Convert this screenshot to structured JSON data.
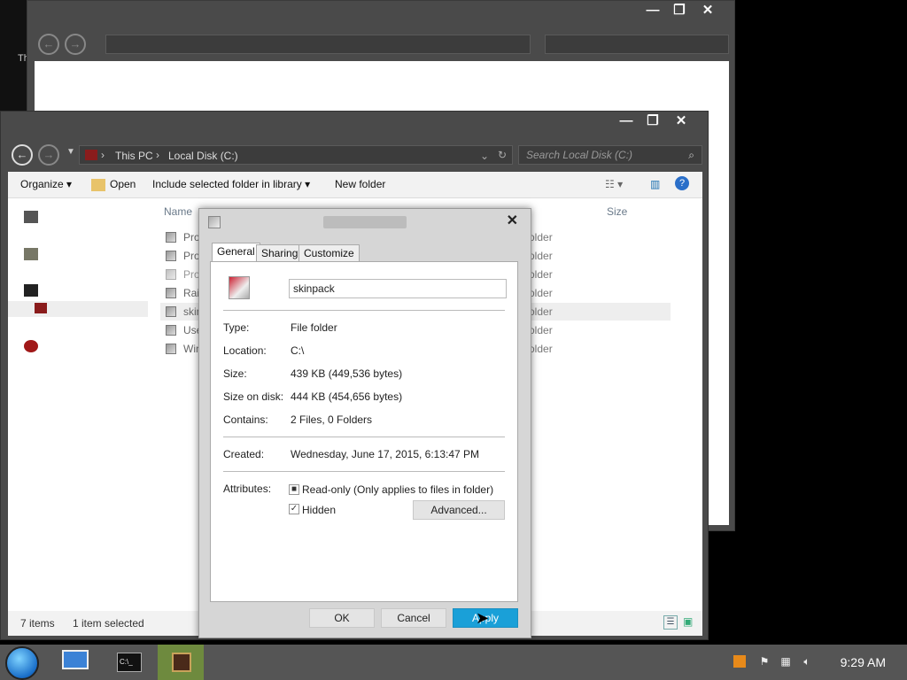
{
  "front_window": {
    "breadcrumb": [
      "This PC",
      "Local Disk (C:)"
    ],
    "search_placeholder": "Search Local Disk (C:)",
    "toolbar": {
      "organize": "Organize",
      "open": "Open",
      "include": "Include selected folder in library",
      "new_folder": "New folder"
    },
    "columns": {
      "name": "Name",
      "size": "Size"
    },
    "files": [
      {
        "name": "Pro",
        "type": "older"
      },
      {
        "name": "Pro",
        "type": "older"
      },
      {
        "name": "Pro",
        "type": "older"
      },
      {
        "name": "Rai",
        "type": "older"
      },
      {
        "name": "skin",
        "type": "older"
      },
      {
        "name": "Use",
        "type": "older"
      },
      {
        "name": "Win",
        "type": "older"
      }
    ],
    "status": {
      "items": "7 items",
      "selected": "1 item selected"
    }
  },
  "dialog": {
    "tabs": [
      "General",
      "Sharing",
      "Customize"
    ],
    "folder_name": "skinpack",
    "type_label": "Type:",
    "type_value": "File folder",
    "location_label": "Location:",
    "location_value": "C:\\",
    "size_label": "Size:",
    "size_value": "439 KB (449,536 bytes)",
    "size_on_disk_label": "Size on disk:",
    "size_on_disk_value": "444 KB (454,656 bytes)",
    "contains_label": "Contains:",
    "contains_value": "2 Files, 0 Folders",
    "created_label": "Created:",
    "created_value": "Wednesday, June 17, 2015, 6:13:47 PM",
    "attributes_label": "Attributes:",
    "readonly_label": "Read-only (Only applies to files in folder)",
    "hidden_label": "Hidden",
    "advanced_label": "Advanced...",
    "ok_label": "OK",
    "cancel_label": "Cancel",
    "apply_label": "Apply"
  },
  "taskbar": {
    "clock": "9:29 AM"
  },
  "caption": {
    "minimize": "—",
    "maximize": "❐",
    "close": "✕"
  },
  "colors": {
    "accent": "#1aa0d8",
    "window_frame": "#4a4a4a",
    "taskbar": "#555555"
  }
}
